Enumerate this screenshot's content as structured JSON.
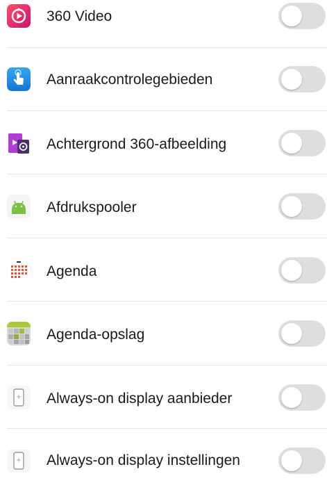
{
  "apps": [
    {
      "label": "360 Video",
      "icon": "video-360-icon",
      "enabled": false
    },
    {
      "label": "Aanraakcontrolegebieden",
      "icon": "touch-control-icon",
      "enabled": false
    },
    {
      "label": "Achtergrond 360-afbeelding",
      "icon": "wallpaper-360-icon",
      "enabled": false
    },
    {
      "label": "Afdrukspooler",
      "icon": "android-icon",
      "enabled": false
    },
    {
      "label": "Agenda",
      "icon": "calendar-icon",
      "enabled": false
    },
    {
      "label": "Agenda-opslag",
      "icon": "calendar-storage-icon",
      "enabled": false
    },
    {
      "label": "Always-on display aanbieder",
      "icon": "phone-display-icon",
      "enabled": false
    },
    {
      "label": "Always-on display instellingen",
      "icon": "phone-display-icon",
      "enabled": false
    }
  ],
  "colors": {
    "toggle_off": "#dedede",
    "toggle_knob": "#ffffff",
    "divider": "#e6e6e6",
    "label_text": "#1a1a1a"
  }
}
